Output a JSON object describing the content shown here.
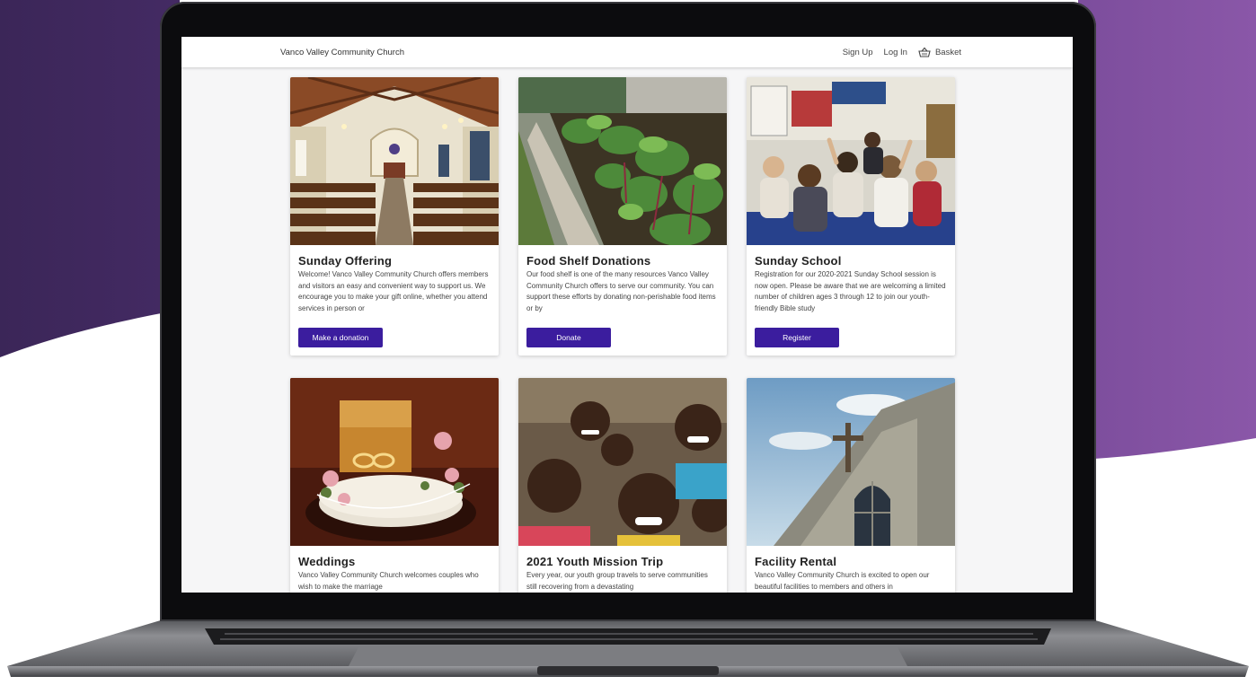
{
  "colors": {
    "background_purple_dark": "#3b2658",
    "background_purple_light": "#8a57a8",
    "accent": "#3b1d9e",
    "nav_bg": "#ffffff",
    "page_bg": "#f6f6f7"
  },
  "site": {
    "brand": "Vanco Valley Community Church",
    "nav": {
      "sign_up": "Sign Up",
      "log_in": "Log In",
      "basket": "Basket",
      "basket_icon": "basket-icon"
    }
  },
  "cards": [
    {
      "title": "Sunday Offering",
      "description": "Welcome! Vanco Valley Community Church offers members and visitors an easy and convenient way to support us. We encourage you to make your gift online, whether you attend services in person or",
      "button": "Make a donation",
      "image": "church-interior-photo"
    },
    {
      "title": "Food Shelf Donations",
      "description": "Our food shelf is one of the many resources Vanco Valley Community Church offers to serve our community. You can support these efforts by donating non-perishable food items or by",
      "button": "Donate",
      "image": "garden-bed-photo"
    },
    {
      "title": "Sunday School",
      "description": "Registration for our 2020-2021 Sunday School session is now open. Please be aware that we are welcoming a limited number of children ages 3 through 12 to join our youth-friendly Bible study",
      "button": "Register",
      "image": "classroom-children-photo"
    },
    {
      "title": "Weddings",
      "description": "Vanco Valley Community Church welcomes couples who wish to make the marriage",
      "image": "wedding-rings-photo"
    },
    {
      "title": "2021 Youth Mission Trip",
      "description": "Every year, our youth group travels to serve communities still recovering from a devastating",
      "image": "smiling-children-photo"
    },
    {
      "title": "Facility Rental",
      "description": "Vanco Valley Community Church is excited to open our beautiful facilities to members and others in",
      "image": "church-exterior-cross-photo"
    }
  ]
}
